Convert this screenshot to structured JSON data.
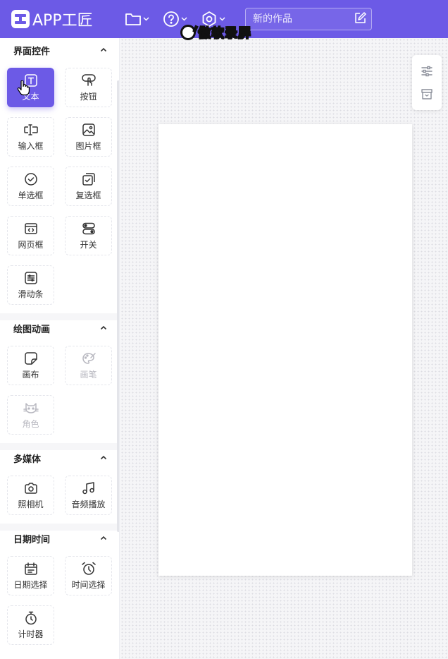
{
  "app": {
    "name": "APP工匠",
    "title_placeholder": "新的作品"
  },
  "watermark": "傲软录屏",
  "colors": {
    "brand": "#6c5ae6",
    "canvas": "#ffffff",
    "disabled": "#b8b8c0"
  },
  "sections": [
    {
      "title": "界面控件",
      "items": [
        {
          "label": "文本",
          "icon": "text-icon",
          "active": true
        },
        {
          "label": "按钮",
          "icon": "tap-icon"
        },
        {
          "label": "输入框",
          "icon": "input-icon"
        },
        {
          "label": "图片框",
          "icon": "image-icon"
        },
        {
          "label": "单选框",
          "icon": "radio-icon"
        },
        {
          "label": "复选框",
          "icon": "checkbox-icon"
        },
        {
          "label": "网页框",
          "icon": "webview-icon"
        },
        {
          "label": "开关",
          "icon": "switch-icon"
        },
        {
          "label": "滑动条",
          "icon": "slider-icon"
        }
      ]
    },
    {
      "title": "绘图动画",
      "items": [
        {
          "label": "画布",
          "icon": "canvas-icon"
        },
        {
          "label": "画笔",
          "icon": "palette-icon",
          "disabled": true
        },
        {
          "label": "角色",
          "icon": "cat-icon",
          "disabled": true
        }
      ]
    },
    {
      "title": "多媒体",
      "items": [
        {
          "label": "照相机",
          "icon": "camera-icon"
        },
        {
          "label": "音频播放",
          "icon": "music-icon"
        }
      ]
    },
    {
      "title": "日期时间",
      "items": [
        {
          "label": "日期选择",
          "icon": "calendar-icon"
        },
        {
          "label": "时间选择",
          "icon": "alarm-clock-icon"
        },
        {
          "label": "计时器",
          "icon": "stopwatch-icon"
        }
      ]
    }
  ]
}
